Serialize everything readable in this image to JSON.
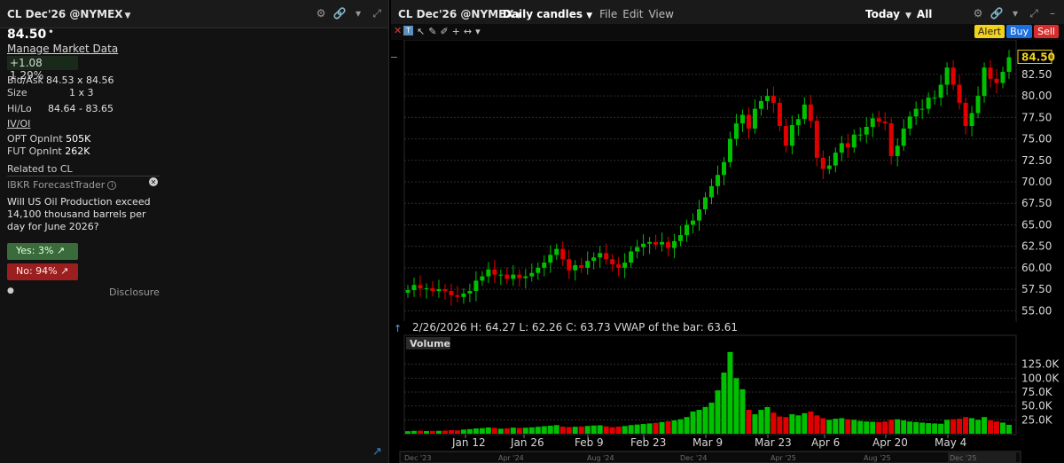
{
  "left": {
    "title": "CL Dec'26 @NYMEX",
    "last": "84.50",
    "manage_market_data": "Manage Market Data",
    "change": "+1.08",
    "change_pct": "1.29%",
    "bid_ask_label": "Bid/Ask",
    "bid_ask": "84.53 x 84.56",
    "size_label": "Size",
    "size": "1 x 3",
    "hilo_label": "Hi/Lo",
    "hilo": "84.64 - 83.65",
    "iv_oi": "IV/OI",
    "opt_label": "OPT OpnInt",
    "opt_value": "505K",
    "fut_label": "FUT OpnInt",
    "fut_value": "262K",
    "related": "Related to CL",
    "forecast": "IBKR ForecastTrader",
    "question": "Will US Oil Production exceed 14,100 thousand barrels per day for June 2026?",
    "yes": "Yes: 3%",
    "no": "No: 94%",
    "disclosure": "Disclosure"
  },
  "right": {
    "title": "CL Dec'26 @NYMEX",
    "mode": "Daily candles",
    "menu": [
      "File",
      "Edit",
      "View"
    ],
    "range_today": "Today",
    "range_all": "All",
    "alert": "Alert",
    "buy": "Buy",
    "sell": "Sell"
  },
  "colors": {
    "up": "#00c000",
    "down": "#e00000",
    "grid": "#2e2e2e",
    "last_tag": "#f2d21b"
  },
  "chart_data": {
    "type": "candlestick",
    "info": "2/26/2026  H: 64.27  L: 62.26  C: 63.73  VWAP of the bar: 63.61",
    "last_label": "84.50",
    "price_ticks": [
      "84.50",
      "82.50",
      "80.00",
      "77.50",
      "75.00",
      "72.50",
      "70.00",
      "67.50",
      "65.00",
      "62.50",
      "60.00",
      "57.50",
      "55.00"
    ],
    "price_range": [
      54.0,
      86.0
    ],
    "volume_label": "Volume",
    "volume_ticks": [
      "125.0K",
      "100.0K",
      "75.0K",
      "50.0K",
      "25.0K"
    ],
    "volume_range": [
      0,
      150000
    ],
    "x_labels": [
      "Jan 12",
      "Jan 26",
      "Feb 9",
      "Feb 23",
      "Mar 9",
      "Mar 23",
      "Apr 6",
      "Apr 20",
      "May 4"
    ],
    "nav_labels": [
      "Dec '23",
      "Apr '24",
      "Aug '24",
      "Dec '24",
      "Apr '25",
      "Aug '25",
      "Dec '25"
    ],
    "closes": [
      57.4,
      58.0,
      57.6,
      57.6,
      57.3,
      57.5,
      57.3,
      56.8,
      56.6,
      57.0,
      57.3,
      58.5,
      59.0,
      59.8,
      59.2,
      59.2,
      58.7,
      59.2,
      58.8,
      59.0,
      59.4,
      60.0,
      60.6,
      61.5,
      62.2,
      61.0,
      59.7,
      60.3,
      60.0,
      60.8,
      61.2,
      61.7,
      61.0,
      60.4,
      60.0,
      60.6,
      61.9,
      62.4,
      62.8,
      63.0,
      62.7,
      63.0,
      62.3,
      63.1,
      63.8,
      65.0,
      65.5,
      66.8,
      68.2,
      69.5,
      70.8,
      72.3,
      75.0,
      76.8,
      77.8,
      76.2,
      78.5,
      79.4,
      80.0,
      79.2,
      76.5,
      74.2,
      76.6,
      77.3,
      79.0,
      77.1,
      72.8,
      71.5,
      71.9,
      73.4,
      74.5,
      74.0,
      75.5,
      75.5,
      76.4,
      77.4,
      77.0,
      76.8,
      73.0,
      74.2,
      76.2,
      77.6,
      78.5,
      78.5,
      79.8,
      79.8,
      81.3,
      83.3,
      81.3,
      79.2,
      76.5,
      78.0,
      80.0,
      83.3,
      82.0,
      81.5,
      82.8,
      84.5
    ],
    "volumes": [
      4500,
      5200,
      5500,
      4800,
      5000,
      5200,
      5600,
      6500,
      6000,
      7500,
      8200,
      9500,
      10000,
      11200,
      10500,
      9000,
      9800,
      11000,
      10200,
      10800,
      11500,
      12500,
      13500,
      14500,
      15500,
      12800,
      12000,
      12500,
      13000,
      14000,
      14800,
      15200,
      13200,
      11800,
      12800,
      13800,
      15500,
      16500,
      17500,
      18500,
      19500,
      21000,
      22500,
      24000,
      26000,
      30000,
      40000,
      43000,
      48000,
      56000,
      78000,
      110000,
      147000,
      100000,
      80000,
      43000,
      35000,
      43000,
      48000,
      38000,
      31000,
      30000,
      35000,
      33000,
      37000,
      40000,
      33000,
      28000,
      25000,
      27000,
      28000,
      26000,
      25000,
      23000,
      22000,
      21500,
      21000,
      22000,
      25000,
      26000,
      24000,
      22000,
      21000,
      20000,
      19000,
      18500,
      18000,
      25000,
      26000,
      27000,
      30000,
      28000,
      25000,
      30000,
      24000,
      22000,
      20000,
      16000
    ]
  }
}
